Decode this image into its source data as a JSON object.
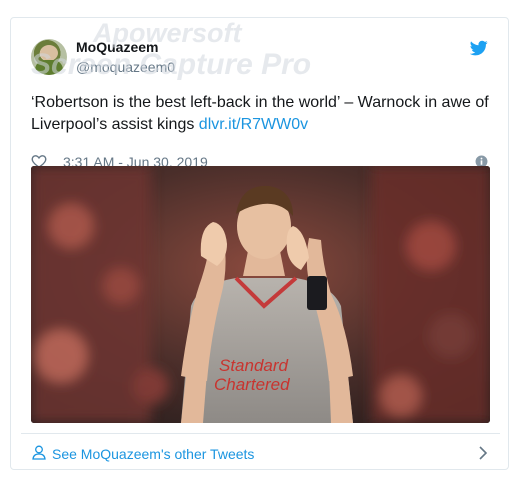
{
  "watermark": {
    "line1": "Apowersoft",
    "line2": "Screen Capture Pro"
  },
  "tweet": {
    "author_name": "MoQuazeem",
    "handle": "@moquazeem0",
    "text": "‘Robertson is the best left-back in the world’ – Warnock in awe of Liverpool’s assist kings",
    "link": "dlvr.it/R7WW0v",
    "timestamp": "3:31 AM - Jun 30, 2019"
  },
  "footer": {
    "see_more_label": "See MoQuazeem's other Tweets"
  },
  "icons": {
    "bird": "twitter-bird-icon",
    "like": "heart-icon",
    "info": "info-icon",
    "person": "person-icon",
    "chevron": "chevron-right-icon"
  },
  "colors": {
    "link": "#1b95e0",
    "text": "#14171a",
    "muted": "#657786",
    "border": "#e1e8ed"
  }
}
